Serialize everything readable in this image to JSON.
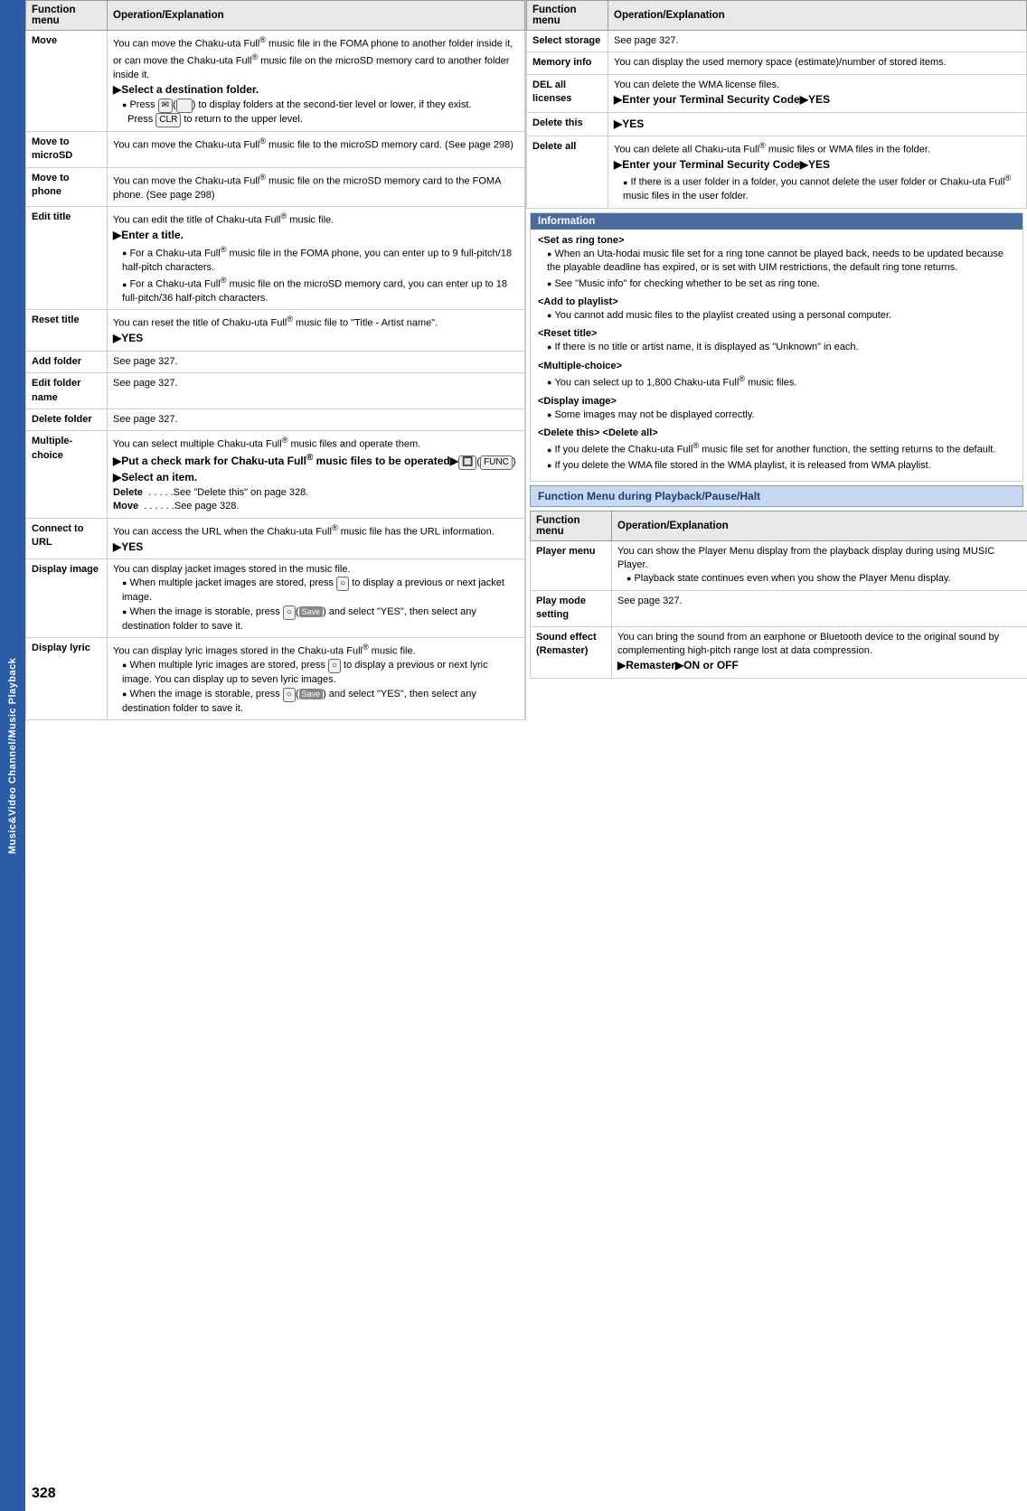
{
  "sidebar": {
    "label": "Music&Video Channel/Music Playback"
  },
  "page_number": "328",
  "left_table": {
    "headers": [
      "Function menu",
      "Operation/Explanation"
    ],
    "rows": [
      {
        "func": "Move",
        "desc": "You can move the Chaku-uta Full® music file in the FOMA phone to another folder inside it, or can move the Chaku-uta Full® music file on the microSD memory card to another folder inside it.\n▶Select a destination folder.\n●Press ✉(　　) to display folders at the second-tier level or lower, if they exist.\n  Press CLR to return to the upper level."
      },
      {
        "func": "Move to microSD",
        "desc": "You can move the Chaku-uta Full® music file to the microSD memory card. (See page 298)"
      },
      {
        "func": "Move to phone",
        "desc": "You can move the Chaku-uta Full® music file on the microSD memory card to the FOMA phone. (See page 298)"
      },
      {
        "func": "Edit title",
        "desc": "You can edit the title of Chaku-uta Full® music file.\n▶Enter a title.\n●For a Chaku-uta Full® music file in the FOMA phone, you can enter up to 9 full-pitch/18 half-pitch characters.\n●For a Chaku-uta Full® music file on the microSD memory card, you can enter up to 18 full-pitch/36 half-pitch characters."
      },
      {
        "func": "Reset title",
        "desc": "You can reset the title of Chaku-uta Full® music file to \"Title - Artist name\".\n▶YES"
      },
      {
        "func": "Add folder",
        "desc": "See page 327."
      },
      {
        "func": "Edit folder name",
        "desc": "See page 327."
      },
      {
        "func": "Delete folder",
        "desc": "See page 327."
      },
      {
        "func": "Multiple-choice",
        "desc": "You can select multiple Chaku-uta Full® music files and operate them.\n▶Put a check mark for Chaku-uta Full® music files to be operated▶🔲(FUNC)\n▶Select an item.\nDelete  . . . . .See \"Delete this\" on page 328.\nMove  . . . . . .See page 328."
      },
      {
        "func": "Connect to URL",
        "desc": "You can access the URL when the Chaku-uta Full® music file has the URL information.\n▶YES"
      },
      {
        "func": "Display image",
        "desc": "You can display jacket images stored in the music file.\n●When multiple jacket images are stored, press ○ to display a previous or next jacket image.\n●When the image is storable, press ○(Save) and select \"YES\", then select any destination folder to save it."
      },
      {
        "func": "Display lyric",
        "desc": "You can display lyric images stored in the Chaku-uta Full® music file.\n●When multiple lyric images are stored, press ○ to display a previous or next lyric image. You can display up to seven lyric images.\n●When the image is storable, press ○(Save) and select \"YES\", then select any destination folder to save it."
      }
    ]
  },
  "right_table": {
    "headers": [
      "Function menu",
      "Operation/Explanation"
    ],
    "rows": [
      {
        "func": "Select storage",
        "desc": "See page 327."
      },
      {
        "func": "Memory info",
        "desc": "You can display the used memory space (estimate)/number of stored items."
      },
      {
        "func": "DEL all licenses",
        "desc": "You can delete the WMA license files.\n▶Enter your Terminal Security Code▶YES"
      },
      {
        "func": "Delete this",
        "desc": "▶YES"
      },
      {
        "func": "Delete all",
        "desc": "You can delete all Chaku-uta Full® music files or WMA files in the folder.\n▶Enter your Terminal Security Code▶YES\n●If there is a user folder in a folder, you cannot delete the user folder or Chaku-uta Full® music files in the user folder."
      }
    ]
  },
  "info_box": {
    "title": "Information",
    "sections": [
      {
        "heading": "<Set as ring tone>",
        "bullets": [
          "When an Uta-hodai music file set for a ring tone cannot be played back, needs to be updated because the playable deadline has expired, or is set with UIM restrictions, the default ring tone returns.",
          "See \"Music info\" for checking whether to be set as ring tone."
        ]
      },
      {
        "heading": "<Add to playlist>",
        "bullets": [
          "You cannot add music files to the playlist created using a personal computer."
        ]
      },
      {
        "heading": "<Reset title>",
        "bullets": [
          "If there is no title or artist name, it is displayed as \"Unknown\" in each."
        ]
      },
      {
        "heading": "<Multiple-choice>",
        "bullets": [
          "You can select up to 1,800 Chaku-uta Full® music files."
        ]
      },
      {
        "heading": "<Display image>",
        "bullets": [
          "Some images may not be displayed correctly."
        ]
      },
      {
        "heading": "<Delete this> <Delete all>",
        "bullets": [
          "If you delete the Chaku-uta Full® music file set for another function, the setting returns to the default.",
          "If you delete the WMA file stored in the WMA playlist, it is released from WMA playlist."
        ]
      }
    ]
  },
  "playback_section": {
    "title": "Function Menu during Playback/Pause/Halt",
    "table": {
      "headers": [
        "Function menu",
        "Operation/Explanation"
      ],
      "rows": [
        {
          "func": "Player menu",
          "desc": "You can show the Player Menu display from the playback display during using MUSIC Player.\n●Playback state continues even when you show the Player Menu display."
        },
        {
          "func": "Play mode setting",
          "desc": "See page 327."
        },
        {
          "func": "Sound effect (Remaster)",
          "desc": "You can bring the sound from an earphone or Bluetooth device to the original sound by complementing high-pitch range lost at data compression.\n▶Remaster▶ON or OFF"
        }
      ]
    }
  }
}
